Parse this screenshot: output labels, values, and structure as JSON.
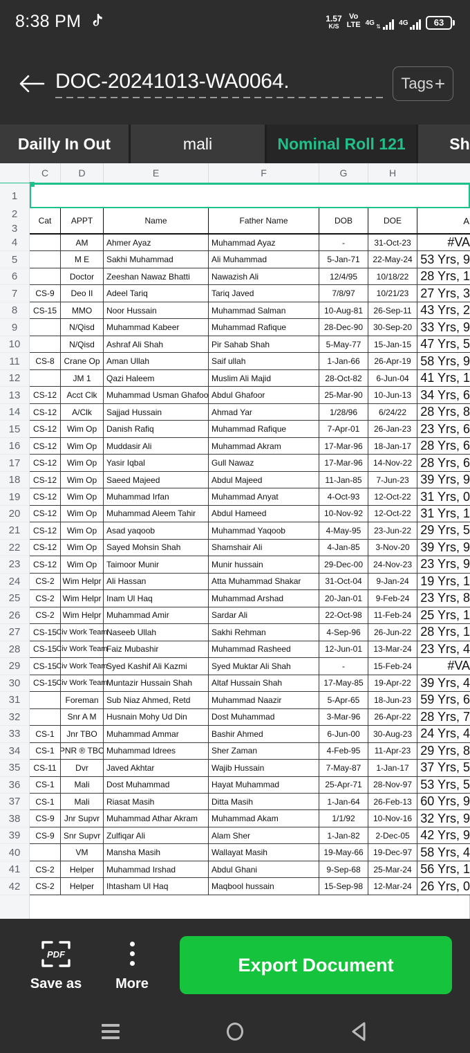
{
  "status_bar": {
    "time": "8:38 PM",
    "app_icon": "tiktok-icon",
    "net_speed_value": "1.57",
    "net_speed_unit": "K/S",
    "volte_top": "Vo",
    "volte_bottom": "LTE",
    "sim1_network": "4G",
    "sim2_network": "4G",
    "battery_percent": "63"
  },
  "title_bar": {
    "back_icon": "back-arrow-icon",
    "document_name": "DOC-20241013-WA0064.",
    "tags_label": "Tags",
    "tags_plus": "+"
  },
  "sheet_tabs": {
    "tabs": [
      {
        "label": "Dailly In Out",
        "active": false
      },
      {
        "label": "mali",
        "active": false
      },
      {
        "label": "Nominal Roll 121",
        "active": true
      },
      {
        "label": "Sh",
        "active": false
      }
    ],
    "active_color": "#1fc08a"
  },
  "spreadsheet": {
    "column_letters": [
      "C",
      "D",
      "E",
      "F",
      "G",
      "H",
      ""
    ],
    "selected_cell_row": "1",
    "header_row_numbers": [
      "2",
      "3"
    ],
    "headers": [
      "Cat",
      "APPT",
      "Name",
      "Father Name",
      "DOB",
      "DOE",
      "A"
    ],
    "rows": [
      {
        "n": "4",
        "cat": "",
        "appt": "AM",
        "name": "Ahmer Ayaz",
        "father": "Muhammad Ayaz",
        "dob": "-",
        "doe": "31-Oct-23",
        "age": "#VA"
      },
      {
        "n": "5",
        "cat": "",
        "appt": "M E",
        "name": "Sakhi Muhammad",
        "father": "Ali Muhammad",
        "dob": "5-Jan-71",
        "doe": "22-May-24",
        "age": "53 Yrs, 9"
      },
      {
        "n": "6",
        "cat": "",
        "appt": "Doctor",
        "name": "Zeeshan Nawaz Bhatti",
        "father": "Nawazish Ali",
        "dob": "12/4/95",
        "doe": "10/18/22",
        "age": "28 Yrs, 1"
      },
      {
        "n": "7",
        "cat": "CS-9",
        "appt": "Deo II",
        "name": "Adeel Tariq",
        "father": "Tariq Javed",
        "dob": "7/8/97",
        "doe": "10/21/23",
        "age": "27 Yrs, 3"
      },
      {
        "n": "8",
        "cat": "CS-15",
        "appt": "MMO",
        "name": "Noor Hussain",
        "father": "Muhammad Salman",
        "dob": "10-Aug-81",
        "doe": "26-Sep-11",
        "age": "43 Yrs, 2"
      },
      {
        "n": "9",
        "cat": "",
        "appt": "N/Qisd",
        "name": "Muhammad Kabeer",
        "father": "Muhammad Rafique",
        "dob": "28-Dec-90",
        "doe": "30-Sep-20",
        "age": "33 Yrs, 9"
      },
      {
        "n": "10",
        "cat": "",
        "appt": "N/Qisd",
        "name": "Ashraf Ali Shah",
        "father": "Pir Sahab Shah",
        "dob": "5-May-77",
        "doe": "15-Jan-15",
        "age": "47 Yrs, 5"
      },
      {
        "n": "11",
        "cat": "CS-8",
        "appt": "Crane Op",
        "name": "Aman Ullah",
        "father": "Saif ullah",
        "dob": "1-Jan-66",
        "doe": "26-Apr-19",
        "age": "58 Yrs, 9"
      },
      {
        "n": "12",
        "cat": "",
        "appt": "JM 1",
        "name": "Qazi Haleem",
        "father": "Muslim Ali Majid",
        "dob": "28-Oct-82",
        "doe": "6-Jun-04",
        "age": "41 Yrs, 1"
      },
      {
        "n": "13",
        "cat": "CS-12",
        "appt": "Acct Clk",
        "name": "Muhammad Usman Ghafoor",
        "father": "Abdul Ghafoor",
        "dob": "25-Mar-90",
        "doe": "10-Jun-13",
        "age": "34 Yrs, 6"
      },
      {
        "n": "14",
        "cat": "CS-12",
        "appt": "A/Clk",
        "name": "Sajjad Hussain",
        "father": "Ahmad Yar",
        "dob": "1/28/96",
        "doe": "6/24/22",
        "age": "28 Yrs, 8"
      },
      {
        "n": "15",
        "cat": "CS-12",
        "appt": "Wim Op",
        "name": "Danish Rafiq",
        "father": "Muhammad Rafique",
        "dob": "7-Apr-01",
        "doe": "26-Jan-23",
        "age": "23 Yrs, 6"
      },
      {
        "n": "16",
        "cat": "CS-12",
        "appt": "Wim Op",
        "name": "Muddasir Ali",
        "father": "Muhammad Akram",
        "dob": "17-Mar-96",
        "doe": "18-Jan-17",
        "age": "28 Yrs, 6"
      },
      {
        "n": "17",
        "cat": "CS-12",
        "appt": "Wim Op",
        "name": "Yasir Iqbal",
        "father": "Gull Nawaz",
        "dob": "17-Mar-96",
        "doe": "14-Nov-22",
        "age": "28 Yrs, 6"
      },
      {
        "n": "18",
        "cat": "CS-12",
        "appt": "Wim Op",
        "name": "Saeed Majeed",
        "father": "Abdul Majeed",
        "dob": "11-Jan-85",
        "doe": "7-Jun-23",
        "age": "39 Yrs, 9"
      },
      {
        "n": "19",
        "cat": "CS-12",
        "appt": "Wim Op",
        "name": "Muhammad Irfan",
        "father": "Muhammad Anyat",
        "dob": "4-Oct-93",
        "doe": "12-Oct-22",
        "age": "31 Yrs, 0"
      },
      {
        "n": "20",
        "cat": "CS-12",
        "appt": "Wim Op",
        "name": "Muhammad Aleem Tahir",
        "father": "Abdul Hameed",
        "dob": "10-Nov-92",
        "doe": "12-Oct-22",
        "age": "31 Yrs, 1"
      },
      {
        "n": "21",
        "cat": "CS-12",
        "appt": "Wim Op",
        "name": "Asad yaqoob",
        "father": "Muhammad Yaqoob",
        "dob": "4-May-95",
        "doe": "23-Jun-22",
        "age": "29 Yrs, 5"
      },
      {
        "n": "22",
        "cat": "CS-12",
        "appt": "Wim Op",
        "name": "Sayed Mohsin Shah",
        "father": "Shamshair Ali",
        "dob": "4-Jan-85",
        "doe": "3-Nov-20",
        "age": "39 Yrs, 9"
      },
      {
        "n": "23",
        "cat": "CS-12",
        "appt": "Wim Op",
        "name": "Taimoor Munir",
        "father": "Munir hussain",
        "dob": "29-Dec-00",
        "doe": "24-Nov-23",
        "age": "23 Yrs, 9"
      },
      {
        "n": "24",
        "cat": "CS-2",
        "appt": "Wim Helpr",
        "name": "Ali Hassan",
        "father": "Atta Muhammad Shakar",
        "dob": "31-Oct-04",
        "doe": "9-Jan-24",
        "age": "19 Yrs, 1"
      },
      {
        "n": "25",
        "cat": "CS-2",
        "appt": "Wim Helpr",
        "name": "Inam Ul Haq",
        "father": "Muhammad Arshad",
        "dob": "20-Jan-01",
        "doe": "9-Feb-24",
        "age": "23 Yrs, 8"
      },
      {
        "n": "26",
        "cat": "CS-2",
        "appt": "Wim Helpr",
        "name": "Muhammad Amir",
        "father": "Sardar Ali",
        "dob": "22-Oct-98",
        "doe": "11-Feb-24",
        "age": "25 Yrs, 1"
      },
      {
        "n": "27",
        "cat": "CS-15",
        "appt": "Civ Work Team",
        "name": "Naseeb Ullah",
        "father": "Sakhi Rehman",
        "dob": "4-Sep-96",
        "doe": "26-Jun-22",
        "age": "28 Yrs, 1"
      },
      {
        "n": "28",
        "cat": "CS-15",
        "appt": "Civ Work Team",
        "name": "Faiz Mubashir",
        "father": "Muhammad Rasheed",
        "dob": "12-Jun-01",
        "doe": "13-Mar-24",
        "age": "23 Yrs, 4"
      },
      {
        "n": "29",
        "cat": "CS-15",
        "appt": "Civ Work Team",
        "name": "Syed Kashif Ali Kazmi",
        "father": "Syed Muktar Ali Shah",
        "dob": "-",
        "doe": "15-Feb-24",
        "age": "#VA"
      },
      {
        "n": "30",
        "cat": "CS-15",
        "appt": "Civ Work Team",
        "name": "Muntazir Hussain Shah",
        "father": "Altaf Hussain Shah",
        "dob": "17-May-85",
        "doe": "19-Apr-22",
        "age": "39 Yrs, 4"
      },
      {
        "n": "31",
        "cat": "",
        "appt": "Foreman",
        "name": "Sub Niaz Ahmed, Retd",
        "father": "Muhammad Naazir",
        "dob": "5-Apr-65",
        "doe": "18-Jun-23",
        "age": "59 Yrs, 6"
      },
      {
        "n": "32",
        "cat": "",
        "appt": "Snr A M",
        "name": "Husnain Mohy Ud Din",
        "father": "Dost Muhammad",
        "dob": "3-Mar-96",
        "doe": "26-Apr-22",
        "age": "28 Yrs, 7"
      },
      {
        "n": "33",
        "cat": "CS-1",
        "appt": "Jnr TBO",
        "name": "Muhammad Ammar",
        "father": "Bashir Ahmed",
        "dob": "6-Jun-00",
        "doe": "30-Aug-23",
        "age": "24 Yrs, 4"
      },
      {
        "n": "34",
        "cat": "CS-1",
        "appt": "PNR ® TBO",
        "name": "Muhammad Idrees",
        "father": "Sher Zaman",
        "dob": "4-Feb-95",
        "doe": "11-Apr-23",
        "age": "29 Yrs, 8"
      },
      {
        "n": "35",
        "cat": "CS-11",
        "appt": "Dvr",
        "name": "Javed Akhtar",
        "father": "Wajib Hussain",
        "dob": "7-May-87",
        "doe": "1-Jan-17",
        "age": "37 Yrs, 5"
      },
      {
        "n": "36",
        "cat": "CS-1",
        "appt": "Mali",
        "name": "Dost Muhammad",
        "father": "Hayat Muhammad",
        "dob": "25-Apr-71",
        "doe": "28-Nov-97",
        "age": "53 Yrs, 5"
      },
      {
        "n": "37",
        "cat": "CS-1",
        "appt": "Mali",
        "name": "Riasat Masih",
        "father": "Ditta Masih",
        "dob": "1-Jan-64",
        "doe": "26-Feb-13",
        "age": "60 Yrs, 9"
      },
      {
        "n": "38",
        "cat": "CS-9",
        "appt": "Jnr Supvr",
        "name": "Muhammad Athar Akram",
        "father": "Muhammad Akam",
        "dob": "1/1/92",
        "doe": "10-Nov-16",
        "age": "32 Yrs, 9"
      },
      {
        "n": "39",
        "cat": "CS-9",
        "appt": "Snr Supvr",
        "name": "Zulfiqar Ali",
        "father": "Alam Sher",
        "dob": "1-Jan-82",
        "doe": "2-Dec-05",
        "age": "42 Yrs, 9"
      },
      {
        "n": "40",
        "cat": "",
        "appt": "VM",
        "name": "Mansha Masih",
        "father": "Wallayat Masih",
        "dob": "19-May-66",
        "doe": "19-Dec-97",
        "age": "58 Yrs, 4"
      },
      {
        "n": "41",
        "cat": "CS-2",
        "appt": "Helper",
        "name": "Muhammad Irshad",
        "father": "Abdul Ghani",
        "dob": "9-Sep-68",
        "doe": "25-Mar-24",
        "age": "56 Yrs, 1"
      },
      {
        "n": "42",
        "cat": "CS-2",
        "appt": "Helper",
        "name": "Ihtasham Ul Haq",
        "father": "Maqbool hussain",
        "dob": "15-Sep-98",
        "doe": "12-Mar-24",
        "age": "26 Yrs, 0"
      }
    ]
  },
  "bottom_bar": {
    "save_as_label": "Save as",
    "save_as_icon": "pdf-icon",
    "more_label": "More",
    "more_icon": "kebab-menu-icon",
    "export_label": "Export Document",
    "export_color": "#15c43c"
  },
  "nav_bar": {
    "recents_icon": "menu-icon",
    "home_icon": "home-circle-icon",
    "back_icon": "back-triangle-icon"
  }
}
